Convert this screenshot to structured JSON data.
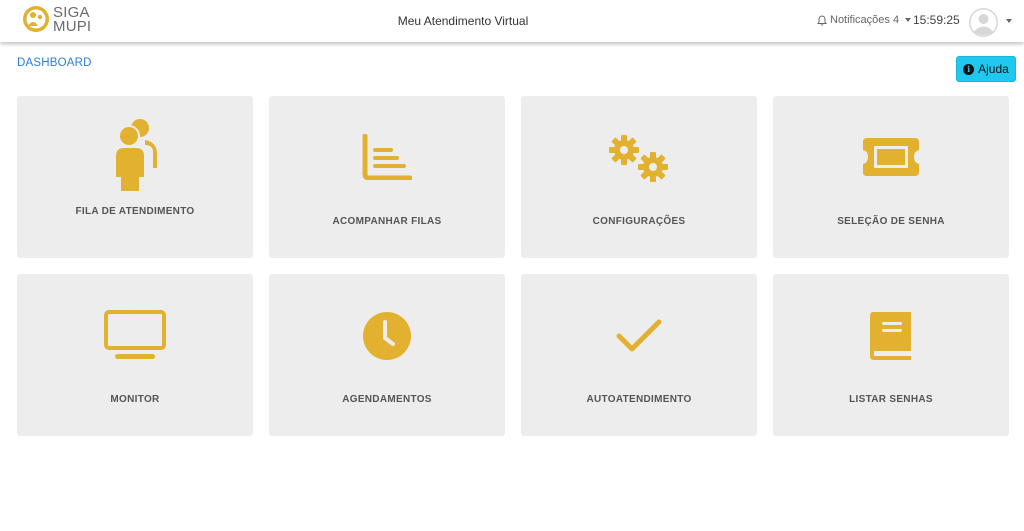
{
  "header": {
    "logo_text_line1": "SIGA",
    "logo_text_line2": "MUPI",
    "title": "Meu Atendimento Virtual",
    "notifications_label": "Notificações 4",
    "clock": "15:59:25"
  },
  "breadcrumb": "DASHBOARD",
  "help_button": {
    "label": "Ajuda"
  },
  "colors": {
    "accent": "#e2b12f",
    "tile_bg": "#ededed",
    "help_bg": "#1ec8ee",
    "link": "#2a7fd4"
  },
  "tiles": [
    {
      "label": "FILA DE ATENDIMENTO",
      "icon": "queue-people-icon"
    },
    {
      "label": "ACOMPANHAR FILAS",
      "icon": "chart-bars-icon"
    },
    {
      "label": "CONFIGURAÇÕES",
      "icon": "gears-icon"
    },
    {
      "label": "SELEÇÃO DE SENHA",
      "icon": "ticket-icon"
    },
    {
      "label": "MONITOR",
      "icon": "monitor-icon"
    },
    {
      "label": "AGENDAMENTOS",
      "icon": "clock-icon"
    },
    {
      "label": "AUTOATENDIMENTO",
      "icon": "checkmark-icon"
    },
    {
      "label": "LISTAR SENHAS",
      "icon": "book-icon"
    }
  ]
}
